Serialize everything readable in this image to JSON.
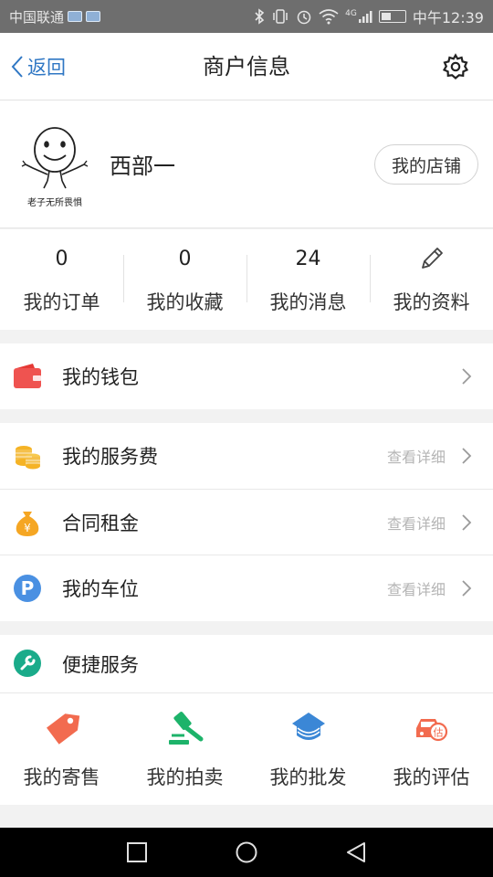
{
  "status_bar": {
    "carrier": "中国联通",
    "network": "4G",
    "time": "中午12:39",
    "battery_level": 0.35
  },
  "header": {
    "back_label": "返回",
    "title": "商户信息"
  },
  "profile": {
    "avatar_caption": "老子无所畏惧",
    "name": "西部一",
    "store_button": "我的店铺"
  },
  "stats": [
    {
      "value": "0",
      "label": "我的订单"
    },
    {
      "value": "0",
      "label": "我的收藏"
    },
    {
      "value": "24",
      "label": "我的消息"
    },
    {
      "value": "",
      "label": "我的资料",
      "icon": "pencil-icon"
    }
  ],
  "wallet": {
    "label": "我的钱包",
    "icon": "wallet-icon",
    "color": "#ef5350"
  },
  "services": [
    {
      "label": "我的服务费",
      "detail": "查看详细",
      "icon": "coins-icon",
      "color": "#f5b325"
    },
    {
      "label": "合同租金",
      "detail": "查看详细",
      "icon": "money-bag-icon",
      "color": "#f5a623"
    },
    {
      "label": "我的车位",
      "detail": "查看详细",
      "icon": "parking-icon",
      "color": "#4a90e2"
    }
  ],
  "quick": {
    "title": "便捷服务",
    "icon": "wrench-icon",
    "color": "#1aab8a",
    "items": [
      {
        "label": "我的寄售",
        "icon": "tag-icon",
        "color": "#f26b4f"
      },
      {
        "label": "我的拍卖",
        "icon": "gavel-icon",
        "color": "#1db36a"
      },
      {
        "label": "我的批发",
        "icon": "box-icon",
        "color": "#3b87d6"
      },
      {
        "label": "我的评估",
        "icon": "car-estimate-icon",
        "color": "#f26b4f"
      },
      {
        "est_char": "估"
      }
    ]
  },
  "colors": {
    "accent": "#2f77c4",
    "detail_text": "#b5b5b5"
  }
}
